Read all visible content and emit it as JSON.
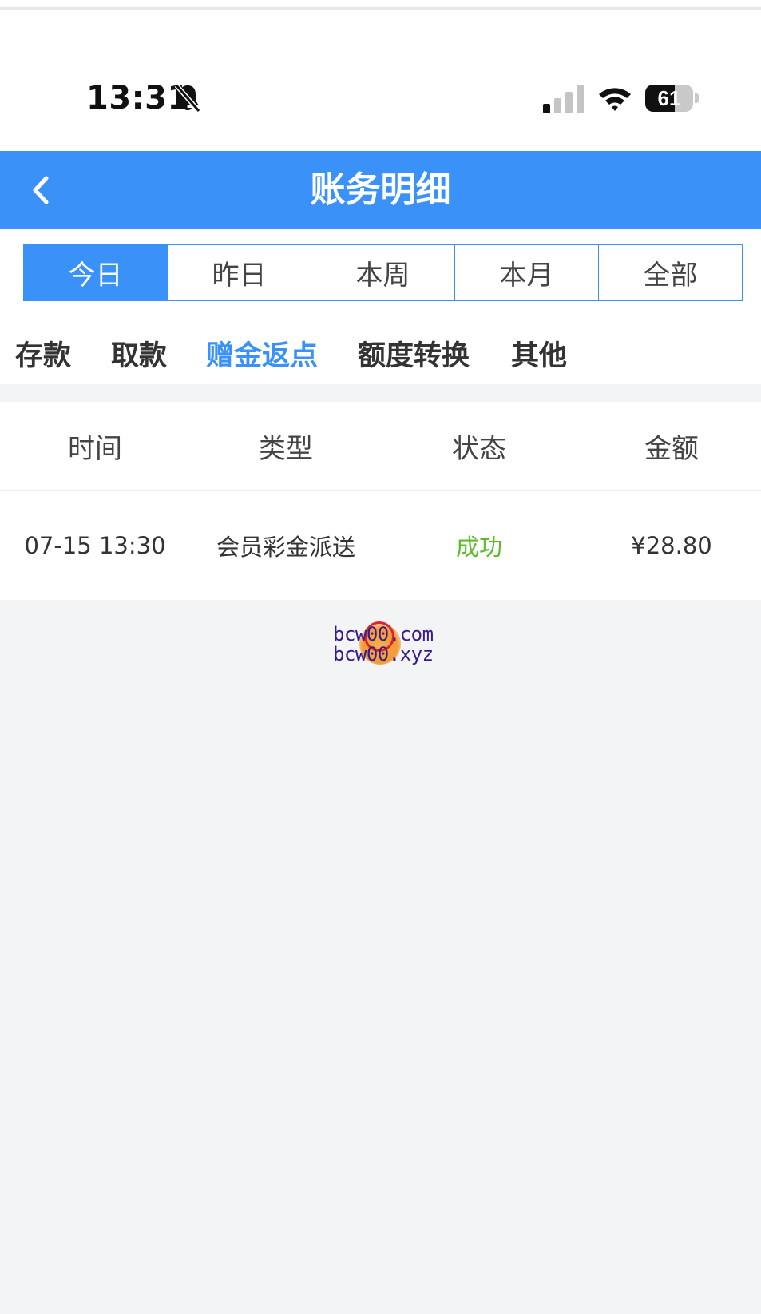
{
  "status_bar": {
    "time": "13:31",
    "battery": "61",
    "battery_level": 0.61
  },
  "header": {
    "title": "账务明细"
  },
  "period_tabs": [
    {
      "label": "今日",
      "active": true
    },
    {
      "label": "昨日",
      "active": false
    },
    {
      "label": "本周",
      "active": false
    },
    {
      "label": "本月",
      "active": false
    },
    {
      "label": "全部",
      "active": false
    }
  ],
  "category_tabs": [
    {
      "label": "存款",
      "active": false
    },
    {
      "label": "取款",
      "active": false
    },
    {
      "label": "赠金返点",
      "active": true
    },
    {
      "label": "额度转换",
      "active": false
    },
    {
      "label": "其他",
      "active": false
    }
  ],
  "table": {
    "headers": [
      "时间",
      "类型",
      "状态",
      "金额"
    ],
    "rows": [
      {
        "time": "07-15 13:30",
        "type": "会员彩金派送",
        "status": "成功",
        "amount": "¥28.80"
      }
    ]
  },
  "watermark": {
    "line1": "bcw00.com",
    "line2": "bcw00.xyz"
  },
  "colors": {
    "primary": "#3a92f9",
    "success": "#5dbb2c",
    "background": "#f3f4f6"
  },
  "icons": [
    "bell-slash-icon",
    "cellular-signal-icon",
    "wifi-icon",
    "battery-icon",
    "back-chevron-icon"
  ]
}
